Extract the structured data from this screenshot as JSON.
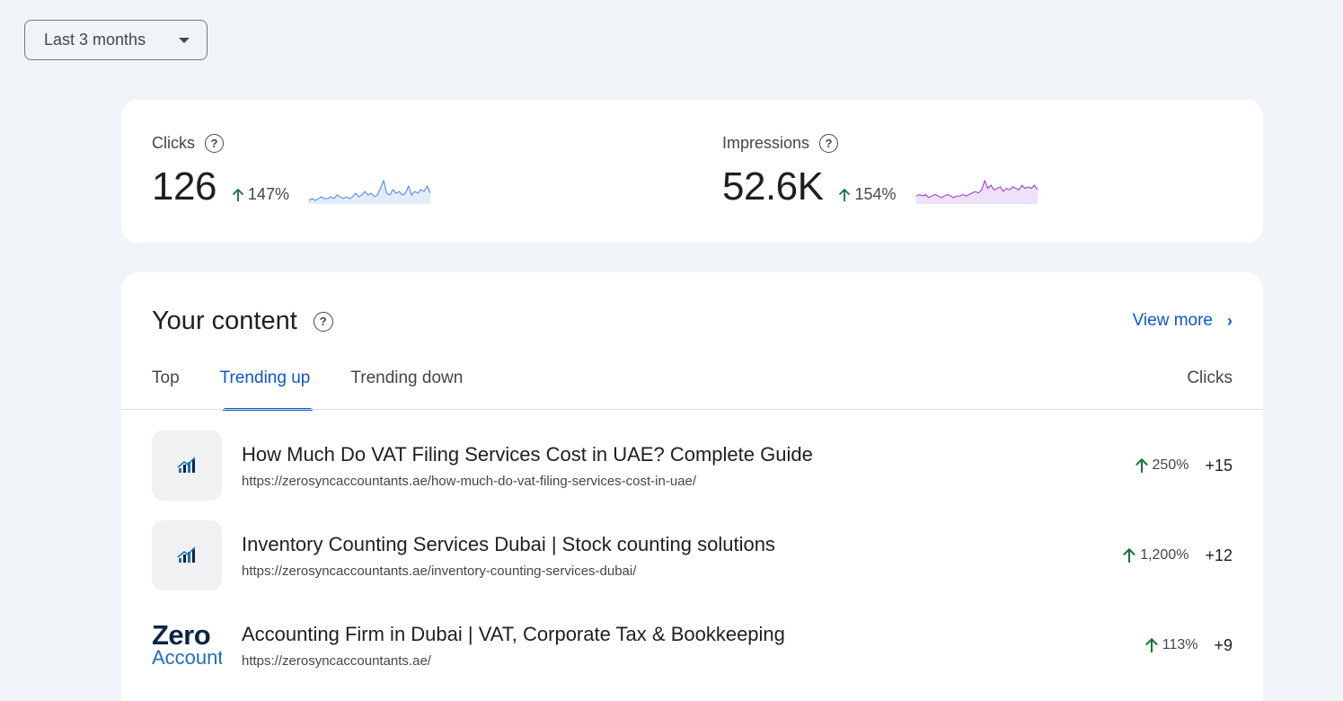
{
  "range": {
    "label": "Last 3 months"
  },
  "metrics": {
    "clicks": {
      "label": "Clicks",
      "value": "126",
      "change": "147%",
      "color": "#4285f4",
      "trend": [
        1,
        2,
        1,
        2,
        3,
        2,
        2,
        3,
        2,
        4,
        3,
        2,
        3,
        2,
        3,
        5,
        3,
        4,
        6,
        4,
        5,
        3,
        4,
        8,
        12,
        5,
        4,
        7,
        5,
        6,
        4,
        5,
        9,
        4,
        6,
        5,
        7,
        6,
        9,
        5
      ]
    },
    "impressions": {
      "label": "Impressions",
      "value": "52.6K",
      "change": "154%",
      "color": "#9334e6",
      "trend": [
        4,
        5,
        4,
        5,
        3,
        4,
        5,
        4,
        3,
        4,
        5,
        4,
        3,
        4,
        4,
        5,
        4,
        5,
        6,
        7,
        6,
        8,
        14,
        9,
        11,
        8,
        9,
        10,
        7,
        9,
        8,
        10,
        9,
        8,
        11,
        9,
        10,
        9,
        11,
        8
      ]
    }
  },
  "content": {
    "title": "Your content",
    "view_more": "View more",
    "tabs": [
      "Top",
      "Trending up",
      "Trending down"
    ],
    "clicks_header": "Clicks",
    "rows": [
      {
        "title": "How Much Do VAT Filing Services Cost in UAE? Complete Guide",
        "url": "https://zerosyncaccountants.ae/how-much-do-vat-filing-services-cost-in-uae/",
        "pct": "250%",
        "count": "+15"
      },
      {
        "title": "Inventory Counting Services Dubai | Stock counting solutions",
        "url": "https://zerosyncaccountants.ae/inventory-counting-services-dubai/",
        "pct": "1,200%",
        "count": "+12"
      },
      {
        "title": "Accounting Firm in Dubai | VAT, Corporate Tax & Bookkeeping",
        "url": "https://zerosyncaccountants.ae/",
        "pct": "113%",
        "count": "+9",
        "logo": {
          "line1": "Zero",
          "line2": "Accounting"
        }
      }
    ]
  },
  "colors": {
    "accent": "#0b57d0",
    "up": "#137333"
  }
}
